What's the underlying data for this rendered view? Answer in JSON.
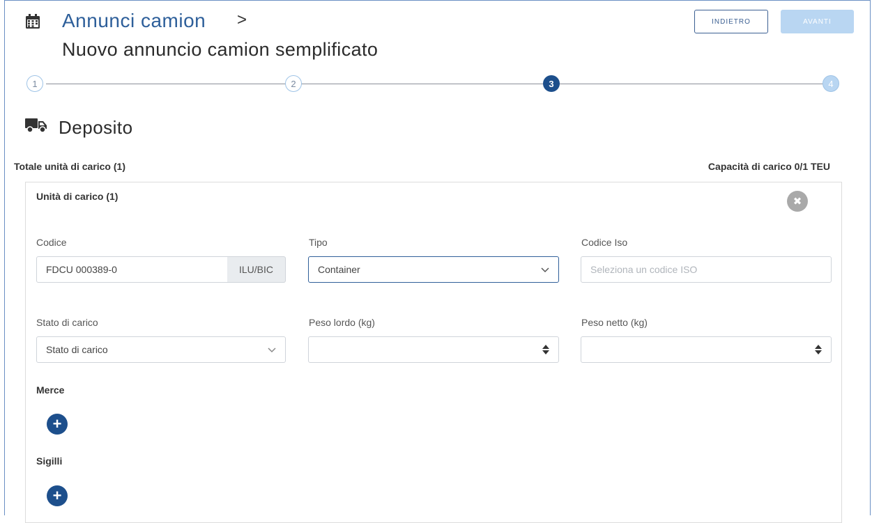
{
  "header": {
    "title": "Annunci camion",
    "breadcrumb_sep": ">",
    "subtitle": "Nuovo annuncio camion semplificato",
    "back_label": "INDIETRO",
    "next_label": "AVANTI"
  },
  "stepper": {
    "steps": [
      "1",
      "2",
      "3",
      "4"
    ],
    "current": 3
  },
  "section": {
    "title": "Deposito"
  },
  "totals": {
    "left": "Totale unità di carico (1)",
    "right": "Capacità di carico 0/1 TEU"
  },
  "card": {
    "title": "Unità di carico (1)",
    "close_glyph": "✖",
    "codice": {
      "label": "Codice",
      "value": "FDCU 000389-0",
      "addon": "ILU/BIC"
    },
    "tipo": {
      "label": "Tipo",
      "value": "Container"
    },
    "codice_iso": {
      "label": "Codice Iso",
      "placeholder": "Seleziona un codice ISO"
    },
    "stato": {
      "label": "Stato di carico",
      "value": "Stato di carico"
    },
    "peso_lordo": {
      "label": "Peso lordo (kg)",
      "value": ""
    },
    "peso_netto": {
      "label": "Peso netto (kg)",
      "value": ""
    },
    "merce": {
      "label": "Merce",
      "add_glyph": "+"
    },
    "sigilli": {
      "label": "Sigilli",
      "add_glyph": "+"
    }
  },
  "colors": {
    "primary": "#1d4f8c",
    "title": "#2e5f9a",
    "disabled_button": "#b9d6f2",
    "step_outline": "#9ec3e6"
  },
  "icons": [
    "calendar-icon",
    "chevron-right-icon",
    "truck-icon",
    "close-icon",
    "chevron-down-icon",
    "plus-icon"
  ]
}
